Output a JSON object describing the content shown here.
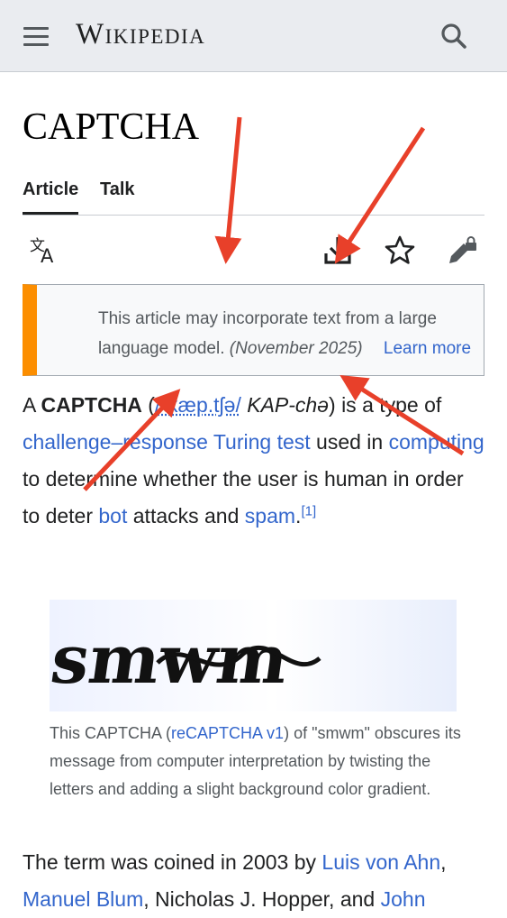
{
  "header": {
    "wordmark": "Wikipedia",
    "menu_icon": "hamburger-menu-icon",
    "search_icon": "search-icon"
  },
  "page": {
    "title": "CAPTCHA",
    "tabs": [
      {
        "label": "Article",
        "active": true
      },
      {
        "label": "Talk",
        "active": false
      }
    ],
    "toolbar": [
      "language-icon",
      "download-icon",
      "star-watch-icon",
      "edit-lock-icon"
    ]
  },
  "notice": {
    "text": "This article may incorporate text from a large language model.",
    "date": "(November 2025)",
    "link": "Learn more",
    "accent_color": "#fc8e00"
  },
  "intro": {
    "a": "A ",
    "term": "CAPTCHA",
    "open": " (",
    "ipa": "/ˈkæp.tʃə/",
    "respell": "KAP-chə",
    "close": ") is a type of ",
    "link_challenge": "challenge–response Turing test",
    "t2": " used in ",
    "link_computing": "computing",
    "t3": " to determine whether the user is human in order to deter ",
    "link_bot": "bot",
    "t4": " attacks and ",
    "link_spam": "spam",
    "t5": ".",
    "ref": "[1]"
  },
  "figure": {
    "image_text": "smwm",
    "caption_a": "This CAPTCHA (",
    "caption_link": "reCAPTCHA v1",
    "caption_b": ") of \"smwm\" obscures its message from computer interpretation by twisting the letters and adding a slight background color gradient."
  },
  "para2": {
    "t1": "The term was coined in 2003 by ",
    "link_ahn": "Luis von Ahn",
    "t2": ",",
    "link_blum": "Manuel Blum",
    "t3": ", Nicholas J. Hopper, and ",
    "link_john": "John"
  },
  "colors": {
    "link": "#3366cc",
    "header_bg": "#eaecf0",
    "annotation_arrow": "#e8402a"
  }
}
